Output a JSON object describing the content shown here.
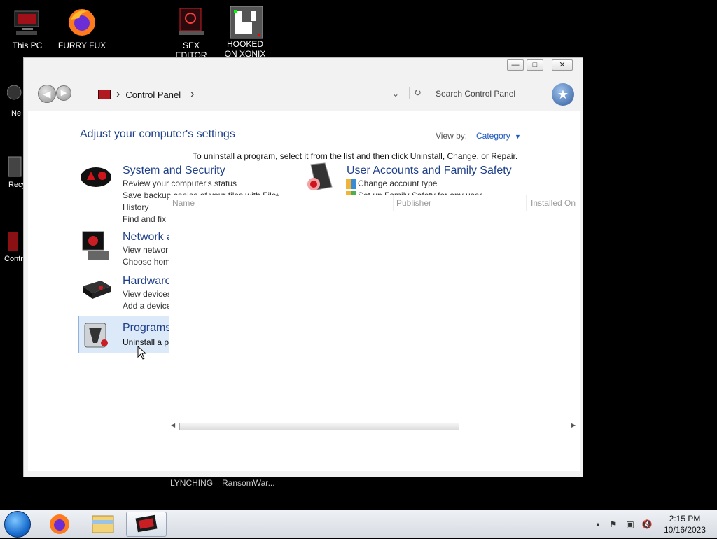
{
  "desktop": {
    "icons": [
      {
        "label": "This PC"
      },
      {
        "label": "FURRY FUX"
      },
      {
        "label": "SEX EDITOR"
      },
      {
        "label": "HOOKED ON XONIX"
      }
    ],
    "edge_fragments": [
      "Ne",
      "Recy",
      "Contr"
    ],
    "bottom_icons": [
      {
        "label": "LYNCHING"
      },
      {
        "label": "RansomWar..."
      }
    ]
  },
  "window": {
    "caption": {
      "minimize": "—",
      "maximize": "□",
      "close": "✕"
    },
    "breadcrumb": {
      "item": "Control Panel",
      "sep": "›"
    },
    "search_placeholder": "Search Control Panel",
    "heading": "Adjust your computer's settings",
    "view_by_label": "View by:",
    "view_by_value": "Category",
    "instruction": "To uninstall a program, select it from the list and then click Uninstall, Change, or Repair.",
    "categories": {
      "system": {
        "title": "System and Security",
        "links": [
          "Review your computer's status",
          "Save backup copies of your files with File",
          "History",
          "Find and fix p"
        ]
      },
      "network": {
        "title": "Network a",
        "links": [
          "View networ",
          "Choose hom"
        ]
      },
      "hardware": {
        "title": "Hardware",
        "links": [
          "View devices",
          "Add a device"
        ]
      },
      "programs": {
        "title": "Programs",
        "links": [
          "Uninstall a pr"
        ]
      },
      "user_accounts": {
        "title": "User Accounts and Family Safety",
        "links": [
          "Change account type",
          "Set up Family Safety for any user"
        ]
      }
    },
    "programs_list": {
      "columns": [
        "Name",
        "Publisher",
        "Installed On"
      ]
    }
  },
  "taskbar": {
    "time": "2:15 PM",
    "date": "10/16/2023",
    "apps": [
      "start-orb",
      "firefox",
      "file-explorer",
      "control-panel"
    ]
  },
  "colors": {
    "accent": "#1e3f8a",
    "desktop_bg": "#000000",
    "taskbar_bg": "#e3e7ec",
    "brand_red": "#c81e24"
  }
}
